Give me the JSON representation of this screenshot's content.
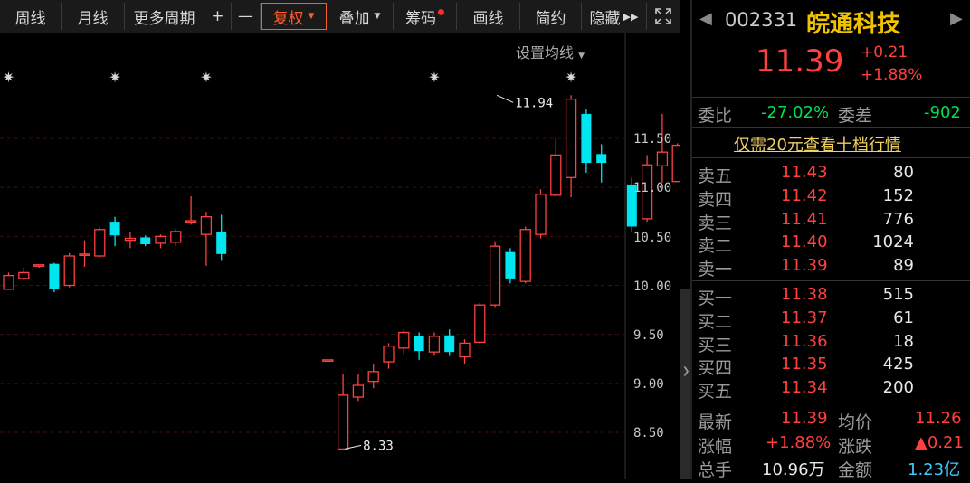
{
  "toolbar": {
    "week": "周线",
    "month": "月线",
    "more_periods": "更多周期",
    "zoom_in": "+",
    "zoom_out": "—",
    "adjust": "复权",
    "overlay": "叠加",
    "chips": "筹码",
    "draw": "画线",
    "simple": "简约",
    "hide": "隐藏",
    "fullscreen_icon": "expand-icon"
  },
  "chart": {
    "ma_setting": "设置均线",
    "y_axis_labels": [
      "11.50",
      "11.00",
      "10.50",
      "10.00",
      "9.50",
      "9.00",
      "8.50"
    ],
    "high_label": "11.94",
    "low_label": "8.33",
    "candles": [
      {
        "o": 9.96,
        "c": 10.1,
        "h": 10.13,
        "l": 9.96
      },
      {
        "o": 10.07,
        "c": 10.13,
        "h": 10.18,
        "l": 10.05
      },
      {
        "o": 10.2,
        "c": 10.21,
        "h": 10.21,
        "l": 10.18
      },
      {
        "o": 10.22,
        "c": 9.96,
        "h": 10.23,
        "l": 9.93
      },
      {
        "o": 10.0,
        "c": 10.3,
        "h": 10.33,
        "l": 9.98
      },
      {
        "o": 10.31,
        "c": 10.32,
        "h": 10.46,
        "l": 10.19
      },
      {
        "o": 10.3,
        "c": 10.57,
        "h": 10.6,
        "l": 10.28
      },
      {
        "o": 10.65,
        "c": 10.51,
        "h": 10.7,
        "l": 10.4
      },
      {
        "o": 10.46,
        "c": 10.48,
        "h": 10.54,
        "l": 10.38
      },
      {
        "o": 10.49,
        "c": 10.42,
        "h": 10.51,
        "l": 10.4
      },
      {
        "o": 10.43,
        "c": 10.5,
        "h": 10.52,
        "l": 10.38
      },
      {
        "o": 10.44,
        "c": 10.55,
        "h": 10.58,
        "l": 10.4
      },
      {
        "o": 10.65,
        "c": 10.66,
        "h": 10.91,
        "l": 10.62
      },
      {
        "o": 10.52,
        "c": 10.7,
        "h": 10.75,
        "l": 10.2
      },
      {
        "o": 10.55,
        "c": 10.32,
        "h": 10.72,
        "l": 10.25
      },
      null,
      null,
      null,
      null,
      null,
      null,
      {
        "o": 9.24,
        "c": 9.24,
        "h": 9.24,
        "l": 9.24
      },
      {
        "o": 8.33,
        "c": 8.88,
        "h": 9.1,
        "l": 8.33
      },
      {
        "o": 8.86,
        "c": 8.98,
        "h": 9.1,
        "l": 8.82
      },
      {
        "o": 9.02,
        "c": 9.12,
        "h": 9.2,
        "l": 8.95
      },
      {
        "o": 9.22,
        "c": 9.38,
        "h": 9.41,
        "l": 9.15
      },
      {
        "o": 9.36,
        "c": 9.52,
        "h": 9.55,
        "l": 9.3
      },
      {
        "o": 9.48,
        "c": 9.33,
        "h": 9.52,
        "l": 9.24
      },
      {
        "o": 9.32,
        "c": 9.48,
        "h": 9.52,
        "l": 9.28
      },
      {
        "o": 9.49,
        "c": 9.32,
        "h": 9.55,
        "l": 9.28
      },
      {
        "o": 9.27,
        "c": 9.41,
        "h": 9.45,
        "l": 9.2
      },
      {
        "o": 9.42,
        "c": 9.8,
        "h": 9.82,
        "l": 9.4
      },
      {
        "o": 9.8,
        "c": 10.4,
        "h": 10.45,
        "l": 9.78
      },
      {
        "o": 10.34,
        "c": 10.07,
        "h": 10.38,
        "l": 10.02
      },
      {
        "o": 10.04,
        "c": 10.57,
        "h": 10.6,
        "l": 10.02
      },
      {
        "o": 10.52,
        "c": 10.93,
        "h": 10.98,
        "l": 10.48
      },
      {
        "o": 10.92,
        "c": 11.33,
        "h": 11.5,
        "l": 10.9
      },
      {
        "o": 11.1,
        "c": 11.9,
        "h": 11.94,
        "l": 10.9
      },
      {
        "o": 11.75,
        "c": 11.25,
        "h": 11.8,
        "l": 11.15
      },
      {
        "o": 11.34,
        "c": 11.25,
        "h": 11.44,
        "l": 11.05
      },
      null,
      {
        "o": 11.03,
        "c": 10.6,
        "h": 11.1,
        "l": 10.55
      },
      {
        "o": 10.68,
        "c": 11.23,
        "h": 11.33,
        "l": 10.65
      },
      {
        "o": 11.22,
        "c": 11.36,
        "h": 11.75,
        "l": 11.05
      },
      {
        "o": 11.06,
        "c": 11.43,
        "h": 11.45,
        "l": 11.06
      }
    ],
    "event_markers_index": [
      0,
      7,
      13,
      28,
      37
    ]
  },
  "colors": {
    "up": "#ff4040",
    "down": "#00e5f0",
    "up_text": "#ff4040",
    "down_text": "#00e050",
    "active_tab": "#ff5a2a",
    "stock_name": "#f0c200"
  },
  "quote": {
    "code": "002331",
    "name": "皖通科技",
    "price": "11.39",
    "change": "+0.21",
    "change_pct": "+1.88%",
    "wei_bi_label": "委比",
    "wei_bi": "-27.02%",
    "wei_cha_label": "委差",
    "wei_cha": "-902",
    "promo": "仅需20元查看十档行情"
  },
  "orderbook": {
    "asks": [
      {
        "label": "卖五",
        "price": "11.43",
        "vol": "80"
      },
      {
        "label": "卖四",
        "price": "11.42",
        "vol": "152"
      },
      {
        "label": "卖三",
        "price": "11.41",
        "vol": "776"
      },
      {
        "label": "卖二",
        "price": "11.40",
        "vol": "1024"
      },
      {
        "label": "卖一",
        "price": "11.39",
        "vol": "89"
      }
    ],
    "bids": [
      {
        "label": "买一",
        "price": "11.38",
        "vol": "515"
      },
      {
        "label": "买二",
        "price": "11.37",
        "vol": "61"
      },
      {
        "label": "买三",
        "price": "11.36",
        "vol": "18"
      },
      {
        "label": "买四",
        "price": "11.35",
        "vol": "425"
      },
      {
        "label": "买五",
        "price": "11.34",
        "vol": "200"
      }
    ]
  },
  "stats": {
    "latest_label": "最新",
    "latest": "11.39",
    "avg_label": "均价",
    "avg": "11.26",
    "pct_label": "涨幅",
    "pct": "+1.88%",
    "chg_label": "涨跌",
    "chg": "▲0.21",
    "vol_label": "总手",
    "vol": "10.96万",
    "amt_label": "金额",
    "amt": "1.23亿"
  }
}
